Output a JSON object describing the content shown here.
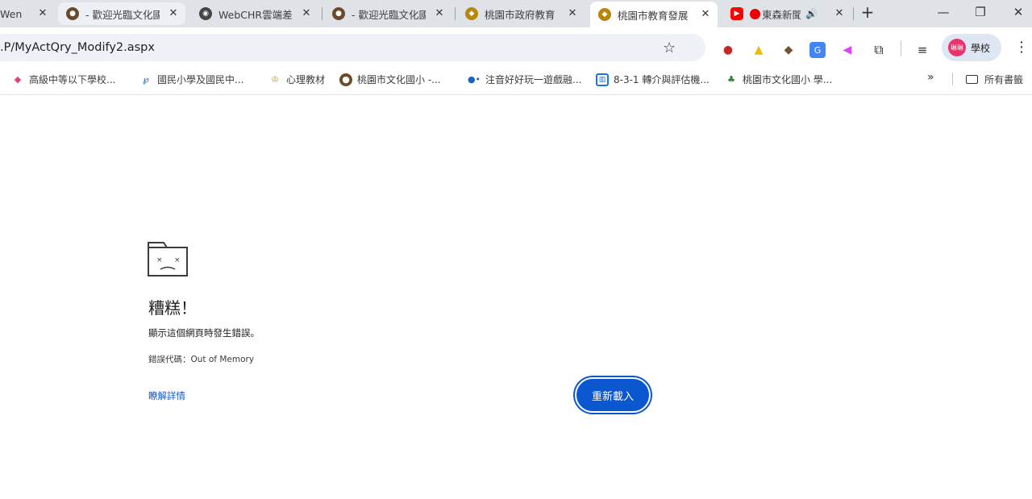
{
  "tabs": [
    {
      "title": "Wen"
    },
    {
      "title": "- 歡迎光臨文化國"
    },
    {
      "title": "WebCHR雲端差"
    },
    {
      "title": "- 歡迎光臨文化國"
    },
    {
      "title": "桃園市政府教育"
    },
    {
      "title": "桃園市教育發展"
    },
    {
      "title": "東森新聞"
    }
  ],
  "address": {
    "url": ".P/MyActQry_Modify2.aspx"
  },
  "profile": {
    "label": "學校",
    "avatar_text": "琳琳"
  },
  "bookmarks": [
    {
      "label": "高級中等以下學校..."
    },
    {
      "label": "國民小學及國民中..."
    },
    {
      "label": "心理教材"
    },
    {
      "label": "桃園市文化國小 -..."
    },
    {
      "label": "注音好好玩一遊戲融..."
    },
    {
      "label": "8-3-1 轉介與評估機..."
    },
    {
      "label": "桃園市文化國小 學..."
    }
  ],
  "all_bookmarks": "所有書籤",
  "error": {
    "title": "糟糕！",
    "description": "顯示這個網頁時發生錯誤。",
    "code": "錯誤代碼：Out of Memory",
    "learn_more": "瞭解詳情",
    "reload": "重新載入"
  },
  "colors": {
    "accent": "#0b57d0",
    "tabstrip": "#dfe3e8",
    "omnibox": "#eef1f5"
  }
}
